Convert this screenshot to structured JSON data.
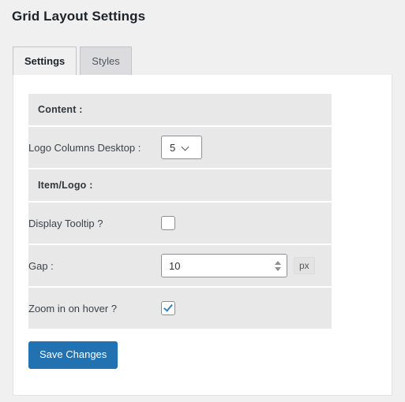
{
  "page": {
    "title": "Grid Layout Settings"
  },
  "tabs": [
    {
      "id": "settings",
      "label": "Settings",
      "active": true
    },
    {
      "id": "styles",
      "label": "Styles",
      "active": false
    }
  ],
  "form": {
    "sections": [
      {
        "heading": "Content :"
      },
      {
        "heading": "Item/Logo :"
      }
    ],
    "fields": {
      "logo_columns_desktop": {
        "label": "Logo Columns Desktop :",
        "value": "5",
        "icon": "chevron-down-icon"
      },
      "display_tooltip": {
        "label": "Display Tooltip ?",
        "checked": false
      },
      "gap": {
        "label": "Gap :",
        "value": "10",
        "unit": "px",
        "spinner_up_icon": "caret-up-icon",
        "spinner_down_icon": "caret-down-icon"
      },
      "zoom_in_on_hover": {
        "label": "Zoom in on hover ?",
        "checked": true
      }
    }
  },
  "actions": {
    "save_label": "Save Changes"
  },
  "colors": {
    "page_background": "#f0f0f1",
    "panel_background": "#ffffff",
    "row_background": "#e8e8e8",
    "primary_button": "#2271b1",
    "tab_inactive": "#dcdcde",
    "checkbox_check": "#3582c4",
    "text": "#3c434a",
    "heading_text": "#1d2327"
  }
}
